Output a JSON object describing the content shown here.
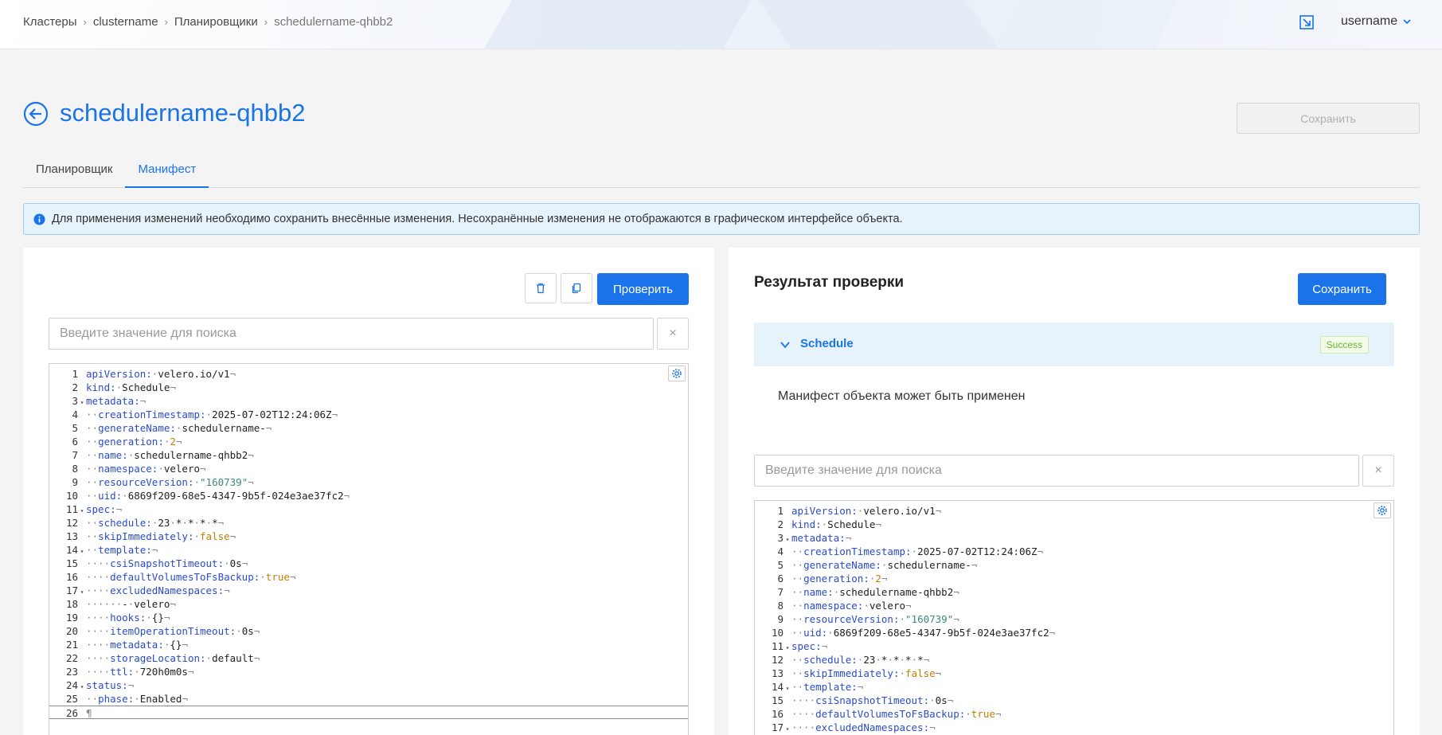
{
  "breadcrumb": [
    "Кластеры",
    "clustername",
    "Планировщики",
    "schedulername-qhbb2"
  ],
  "header": {
    "user": "username"
  },
  "page": {
    "title": "schedulername-qhbb2",
    "save_label": "Сохранить"
  },
  "tabs": [
    "Планировщик",
    "Манифест"
  ],
  "info_text": "Для применения изменений необходимо сохранить внесённые изменения. Несохранённые изменения не отображаются в графическом интерфейсе объекта.",
  "left": {
    "verify_label": "Проверить",
    "search_placeholder": "Введите значение для поиска",
    "clear": "×"
  },
  "right": {
    "title": "Результат проверки",
    "save_label": "Сохранить",
    "accordion_title": "Schedule",
    "badge": "Success",
    "message": "Манифест объекта может быть применен",
    "search_placeholder": "Введите значение для поиска",
    "clear": "×"
  },
  "manifest": [
    {
      "n": "1",
      "f": "",
      "t": [
        [
          "k",
          "apiVersion:"
        ],
        [
          "d",
          "·"
        ],
        [
          "c",
          "velero.io/v1"
        ],
        [
          "d",
          "¬"
        ]
      ]
    },
    {
      "n": "2",
      "f": "",
      "t": [
        [
          "k",
          "kind:"
        ],
        [
          "d",
          "·"
        ],
        [
          "c",
          "Schedule"
        ],
        [
          "d",
          "¬"
        ]
      ]
    },
    {
      "n": "3",
      "f": "▾",
      "t": [
        [
          "k",
          "metadata:"
        ],
        [
          "d",
          "¬"
        ]
      ]
    },
    {
      "n": "4",
      "f": "",
      "t": [
        [
          "d",
          "··"
        ],
        [
          "k",
          "creationTimestamp:"
        ],
        [
          "d",
          "·"
        ],
        [
          "c",
          "2025-07-02T12:24:06Z"
        ],
        [
          "d",
          "¬"
        ]
      ]
    },
    {
      "n": "5",
      "f": "",
      "t": [
        [
          "d",
          "··"
        ],
        [
          "k",
          "generateName:"
        ],
        [
          "d",
          "·"
        ],
        [
          "c",
          "schedulername-"
        ],
        [
          "d",
          "¬"
        ]
      ]
    },
    {
      "n": "6",
      "f": "",
      "t": [
        [
          "d",
          "··"
        ],
        [
          "k",
          "generation:"
        ],
        [
          "d",
          "·"
        ],
        [
          "num",
          "2"
        ],
        [
          "d",
          "¬"
        ]
      ]
    },
    {
      "n": "7",
      "f": "",
      "t": [
        [
          "d",
          "··"
        ],
        [
          "k",
          "name:"
        ],
        [
          "d",
          "·"
        ],
        [
          "c",
          "schedulername-qhbb2"
        ],
        [
          "d",
          "¬"
        ]
      ]
    },
    {
      "n": "8",
      "f": "",
      "t": [
        [
          "d",
          "··"
        ],
        [
          "k",
          "namespace:"
        ],
        [
          "d",
          "·"
        ],
        [
          "c",
          "velero"
        ],
        [
          "d",
          "¬"
        ]
      ]
    },
    {
      "n": "9",
      "f": "",
      "t": [
        [
          "d",
          "··"
        ],
        [
          "k",
          "resourceVersion:"
        ],
        [
          "d",
          "·"
        ],
        [
          "str",
          "\"160739\""
        ],
        [
          "d",
          "¬"
        ]
      ]
    },
    {
      "n": "10",
      "f": "",
      "t": [
        [
          "d",
          "··"
        ],
        [
          "k",
          "uid:"
        ],
        [
          "d",
          "·"
        ],
        [
          "c",
          "6869f209-68e5-4347-9b5f-024e3ae37fc2"
        ],
        [
          "d",
          "¬"
        ]
      ]
    },
    {
      "n": "11",
      "f": "▾",
      "t": [
        [
          "k",
          "spec:"
        ],
        [
          "d",
          "¬"
        ]
      ]
    },
    {
      "n": "12",
      "f": "",
      "t": [
        [
          "d",
          "··"
        ],
        [
          "k",
          "schedule:"
        ],
        [
          "d",
          "·"
        ],
        [
          "c",
          "23"
        ],
        [
          "d",
          "·"
        ],
        [
          "c",
          "*"
        ],
        [
          "d",
          "·"
        ],
        [
          "c",
          "*"
        ],
        [
          "d",
          "·"
        ],
        [
          "c",
          "*"
        ],
        [
          "d",
          "·"
        ],
        [
          "c",
          "*"
        ],
        [
          "d",
          "¬"
        ]
      ]
    },
    {
      "n": "13",
      "f": "",
      "t": [
        [
          "d",
          "··"
        ],
        [
          "k",
          "skipImmediately:"
        ],
        [
          "d",
          "·"
        ],
        [
          "bool",
          "false"
        ],
        [
          "d",
          "¬"
        ]
      ]
    },
    {
      "n": "14",
      "f": "▾",
      "t": [
        [
          "d",
          "··"
        ],
        [
          "k",
          "template:"
        ],
        [
          "d",
          "¬"
        ]
      ]
    },
    {
      "n": "15",
      "f": "",
      "t": [
        [
          "d",
          "····"
        ],
        [
          "k",
          "csiSnapshotTimeout:"
        ],
        [
          "d",
          "·"
        ],
        [
          "c",
          "0s"
        ],
        [
          "d",
          "¬"
        ]
      ]
    },
    {
      "n": "16",
      "f": "",
      "t": [
        [
          "d",
          "····"
        ],
        [
          "k",
          "defaultVolumesToFsBackup:"
        ],
        [
          "d",
          "·"
        ],
        [
          "bool",
          "true"
        ],
        [
          "d",
          "¬"
        ]
      ]
    },
    {
      "n": "17",
      "f": "▾",
      "t": [
        [
          "d",
          "····"
        ],
        [
          "k",
          "excludedNamespaces:"
        ],
        [
          "d",
          "¬"
        ]
      ]
    },
    {
      "n": "18",
      "f": "",
      "t": [
        [
          "d",
          "······"
        ],
        [
          "c",
          "-"
        ],
        [
          "d",
          "·"
        ],
        [
          "c",
          "velero"
        ],
        [
          "d",
          "¬"
        ]
      ]
    },
    {
      "n": "19",
      "f": "",
      "t": [
        [
          "d",
          "····"
        ],
        [
          "k",
          "hooks:"
        ],
        [
          "d",
          "·"
        ],
        [
          "c",
          "{}"
        ],
        [
          "d",
          "¬"
        ]
      ]
    },
    {
      "n": "20",
      "f": "",
      "t": [
        [
          "d",
          "····"
        ],
        [
          "k",
          "itemOperationTimeout:"
        ],
        [
          "d",
          "·"
        ],
        [
          "c",
          "0s"
        ],
        [
          "d",
          "¬"
        ]
      ]
    },
    {
      "n": "21",
      "f": "",
      "t": [
        [
          "d",
          "····"
        ],
        [
          "k",
          "metadata:"
        ],
        [
          "d",
          "·"
        ],
        [
          "c",
          "{}"
        ],
        [
          "d",
          "¬"
        ]
      ]
    },
    {
      "n": "22",
      "f": "",
      "t": [
        [
          "d",
          "····"
        ],
        [
          "k",
          "storageLocation:"
        ],
        [
          "d",
          "·"
        ],
        [
          "c",
          "default"
        ],
        [
          "d",
          "¬"
        ]
      ]
    },
    {
      "n": "23",
      "f": "",
      "t": [
        [
          "d",
          "····"
        ],
        [
          "k",
          "ttl:"
        ],
        [
          "d",
          "·"
        ],
        [
          "c",
          "720h0m0s"
        ],
        [
          "d",
          "¬"
        ]
      ]
    },
    {
      "n": "24",
      "f": "▾",
      "t": [
        [
          "k",
          "status:"
        ],
        [
          "d",
          "¬"
        ]
      ]
    },
    {
      "n": "25",
      "f": "",
      "t": [
        [
          "d",
          "··"
        ],
        [
          "k",
          "phase:"
        ],
        [
          "d",
          "·"
        ],
        [
          "c",
          "Enabled"
        ],
        [
          "d",
          "¬"
        ]
      ]
    },
    {
      "n": "26",
      "f": "",
      "t": [
        [
          "d",
          "¶"
        ]
      ]
    }
  ]
}
